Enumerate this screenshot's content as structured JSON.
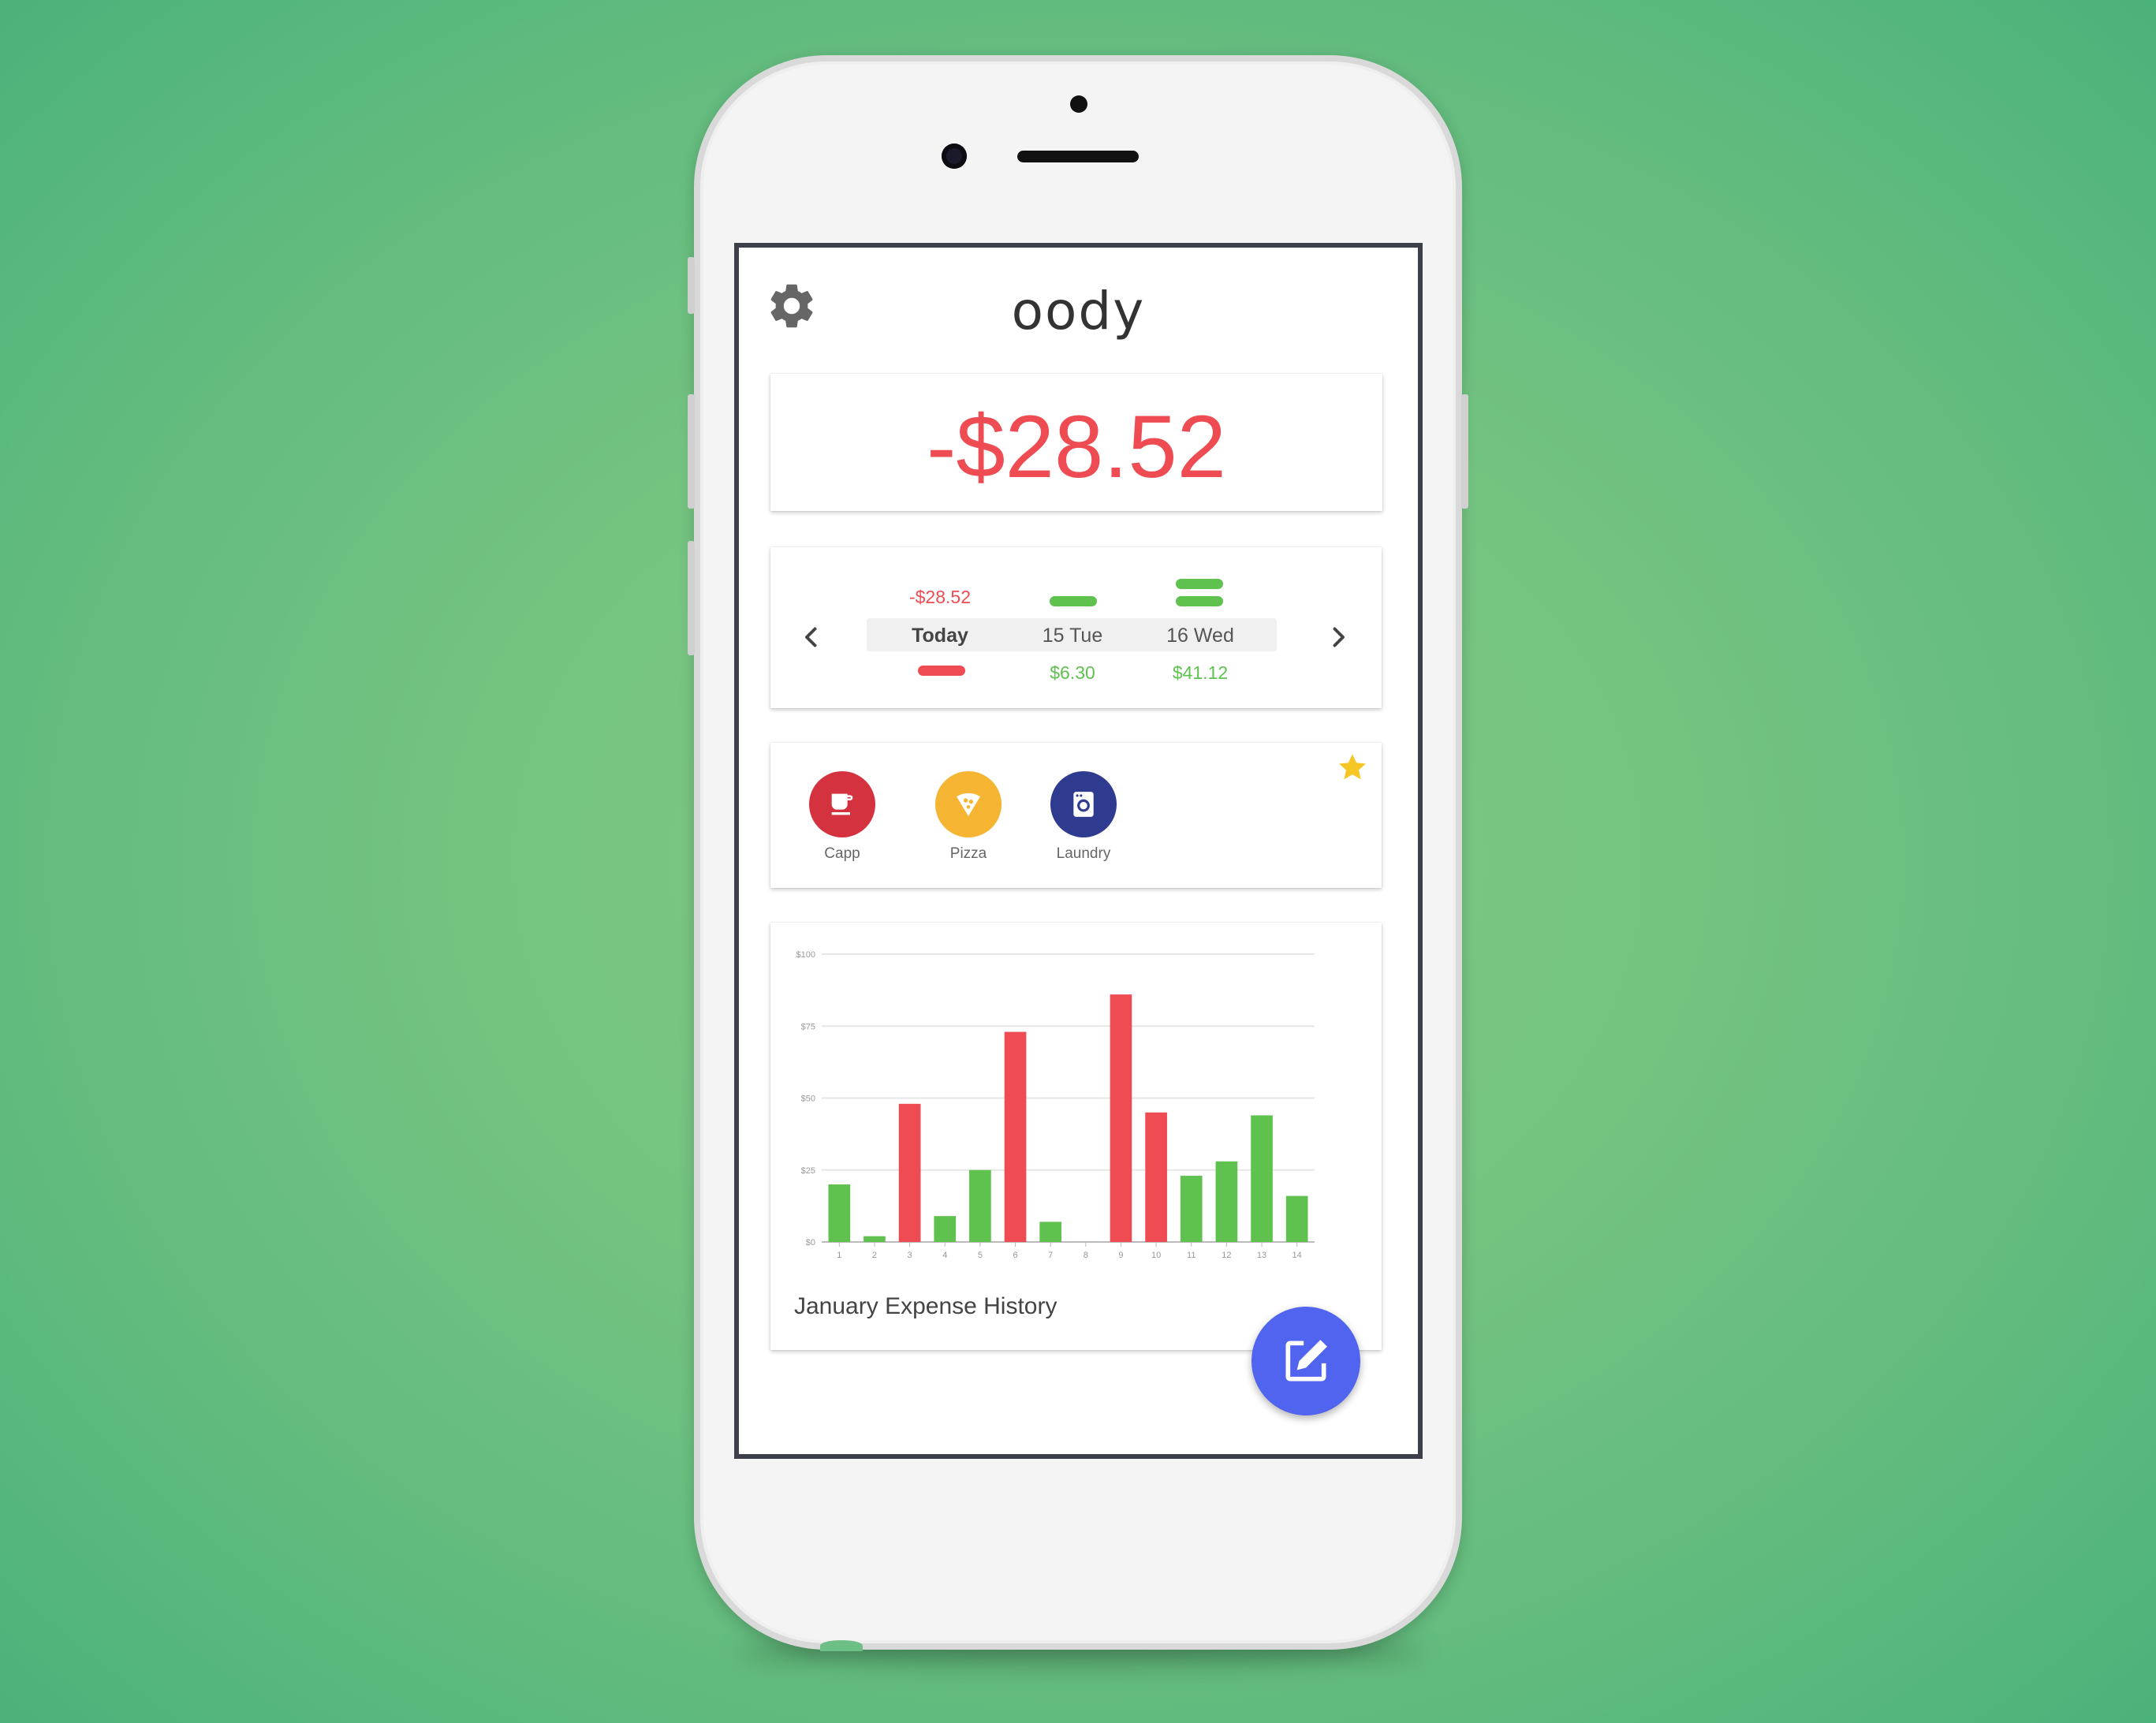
{
  "app": {
    "title": "oody"
  },
  "balance": {
    "value": "-$28.52",
    "color": "#ee4c52"
  },
  "days": {
    "items": [
      {
        "label": "Today",
        "top_amount": "-$28.52",
        "bottom_amount": "",
        "selected": true
      },
      {
        "label": "15 Tue",
        "top_amount": "",
        "bottom_amount": "$6.30"
      },
      {
        "label": "16 Wed",
        "top_amount": "",
        "bottom_amount": "$41.12"
      }
    ]
  },
  "favorites": {
    "items": [
      {
        "label": "Capp",
        "icon": "coffee-cup-icon",
        "color": "#d5323f"
      },
      {
        "label": "Pizza",
        "icon": "pizza-icon",
        "color": "#f5b533"
      },
      {
        "label": "Laundry",
        "icon": "washing-machine-icon",
        "color": "#2f3b8f"
      }
    ],
    "star_icon": "star-icon"
  },
  "chart_data": {
    "type": "bar",
    "title": "January Expense History",
    "categories": [
      "1",
      "2",
      "3",
      "4",
      "5",
      "6",
      "7",
      "8",
      "9",
      "10",
      "11",
      "12",
      "13",
      "14"
    ],
    "values": [
      20,
      2,
      48,
      9,
      25,
      73,
      7,
      0,
      86,
      45,
      23,
      28,
      44,
      16
    ],
    "bar_colors": [
      "#5fc24f",
      "#5fc24f",
      "#ee4c52",
      "#5fc24f",
      "#5fc24f",
      "#ee4c52",
      "#5fc24f",
      "#5fc24f",
      "#ee4c52",
      "#ee4c52",
      "#5fc24f",
      "#5fc24f",
      "#5fc24f",
      "#5fc24f"
    ],
    "y_ticks": [
      "$0",
      "$25",
      "$50",
      "$75",
      "$100"
    ],
    "ylim": [
      0,
      100
    ],
    "grid": true
  },
  "colors": {
    "negative": "#ee4c52",
    "positive": "#5fc24f",
    "accent": "#5064f0"
  }
}
